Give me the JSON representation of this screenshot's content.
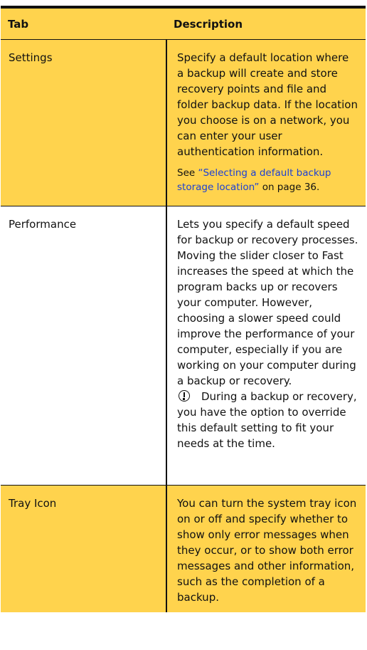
{
  "table": {
    "headers": {
      "tab": "Tab",
      "description": "Description"
    },
    "rows": [
      {
        "tab": "Settings",
        "description": "Specify a default location where a backup will create and store recovery points and file and folder backup data. If the location you choose is on a network, you can enter your user authentication information.",
        "see_prefix": "See ",
        "see_link": "“Selecting a default backup storage location”",
        "see_suffix": " on page 36."
      },
      {
        "tab": "Performance",
        "description": "Lets you specify a default speed for backup or recovery processes. Moving the slider closer to Fast increases the speed at which the program backs up or recovers your computer. However, choosing a slower speed could improve the performance of your computer, especially if you are working on your computer during a backup or recovery.",
        "note": "During a backup or recovery, you have the option to override this default setting to fit your needs at the time."
      },
      {
        "tab": "Tray Icon",
        "description": "You can turn the system tray icon on or off and specify whether to show only error messages when they occur, or to show both error messages and other information, such as the completion of a backup."
      }
    ]
  },
  "colors": {
    "highlight": "#ffd34d",
    "link": "#1a3fd6",
    "rule": "#111111"
  },
  "icons": {
    "note": "important-note-icon"
  }
}
